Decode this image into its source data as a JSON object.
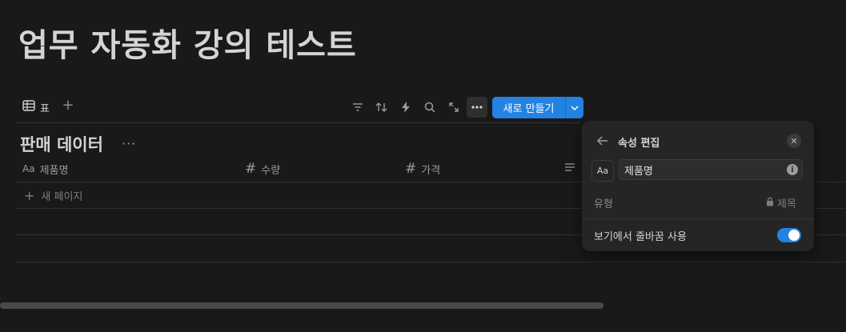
{
  "page": {
    "title": "업무 자동화 강의 테스트"
  },
  "view": {
    "tab_label": "표"
  },
  "toolbar": {
    "new_label": "새로 만들기"
  },
  "database": {
    "title": "판매 데이터",
    "columns": [
      {
        "type_icon": "Aa",
        "label": "제품명"
      },
      {
        "type_icon": "#",
        "label": "수량"
      },
      {
        "type_icon": "#",
        "label": "가격"
      }
    ],
    "new_page_label": "새 페이지"
  },
  "popover": {
    "title": "속성 편집",
    "type_icon_text": "Aa",
    "name_value": "제품명",
    "type_label": "유형",
    "type_value": "제목",
    "wrap_label": "보기에서 줄바꿈 사용",
    "wrap_enabled": true
  },
  "colors": {
    "accent": "#2383e2",
    "background": "#191919",
    "panel": "#252525"
  }
}
